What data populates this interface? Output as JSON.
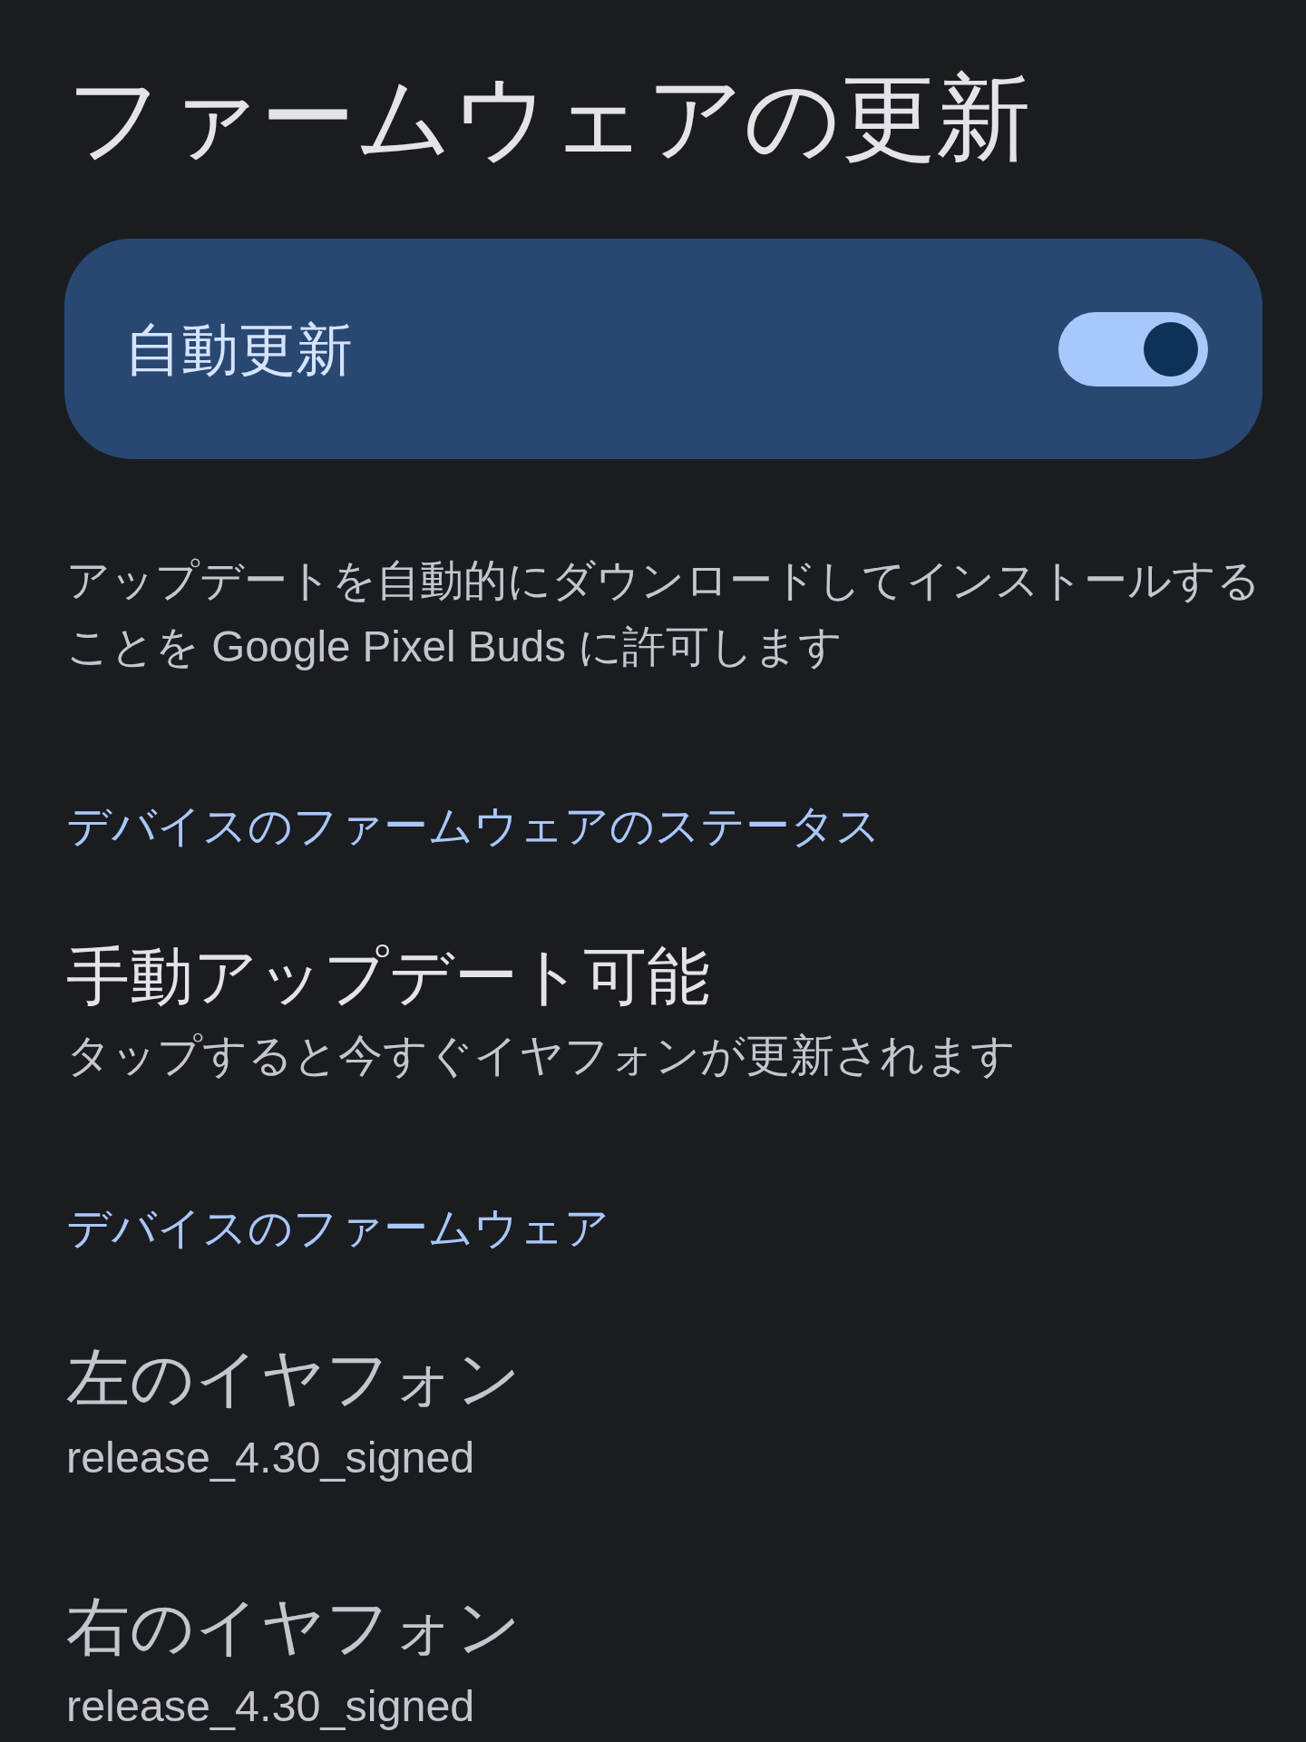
{
  "title": "ファームウェアの更新",
  "auto_update": {
    "label": "自動更新",
    "on": true
  },
  "description": "アップデートを自動的にダウンロードしてインストールすることを Google Pixel Buds に許可します",
  "sections": [
    {
      "header": "デバイスのファームウェアのステータス",
      "items": [
        {
          "title": "手動アップデート可能",
          "subtitle": "タップすると今すぐイヤフォンが更新されます"
        }
      ]
    },
    {
      "header": "デバイスのファームウェア",
      "items": [
        {
          "title": "左のイヤフォン",
          "subtitle": "release_4.30_signed"
        },
        {
          "title": "右のイヤフォン",
          "subtitle": "release_4.30_signed"
        }
      ]
    }
  ]
}
